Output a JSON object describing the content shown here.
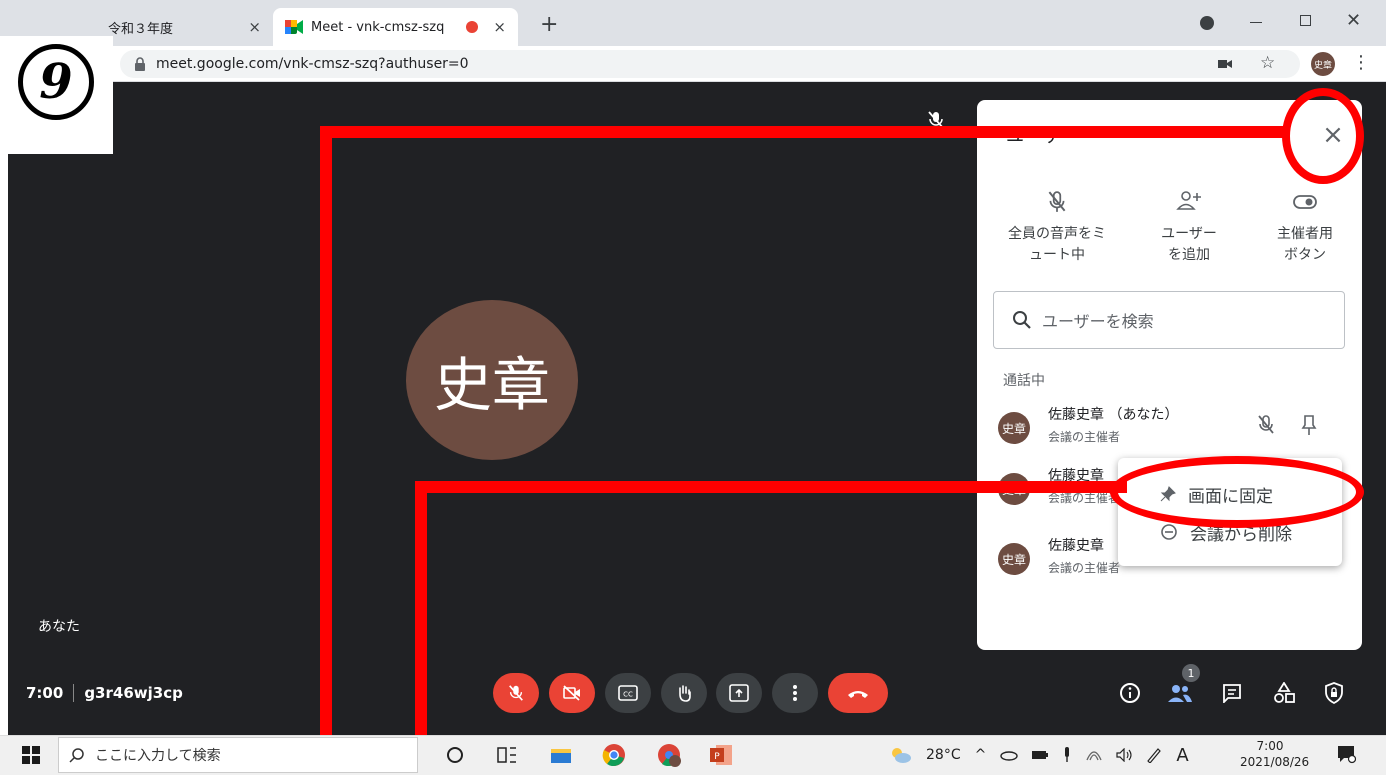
{
  "browser": {
    "tab1_title": "令和３年度",
    "tab2_title": "Meet - vnk-cmsz-szq",
    "tab_close": "×",
    "new_tab": "+",
    "url": "meet.google.com/vnk-cmsz-szq?authuser=0",
    "profile": "史章"
  },
  "step_number": "9",
  "meeting": {
    "avatar_text": "史章",
    "self_label": "あなた",
    "time": "7:00",
    "code": "g3r46wj3cp",
    "people_count": "1"
  },
  "panel": {
    "title": "ユーザー",
    "close": "×",
    "actions": [
      {
        "line1": "全員の音声をミ",
        "line2": "ュート中"
      },
      {
        "line1": "ユーザー",
        "line2": "を追加"
      },
      {
        "line1": "主催者用",
        "line2": "ボタン"
      }
    ],
    "search_placeholder": "ユーザーを検索",
    "in_call": "通話中",
    "people": [
      {
        "avatar": "史章",
        "name": "佐藤史章 （あなた）",
        "role": "会議の主催者"
      },
      {
        "avatar": "史章",
        "name": "佐藤史章",
        "role": "会議の主催者"
      },
      {
        "avatar": "史章",
        "name": "佐藤史章",
        "role": "会議の主催者"
      }
    ],
    "menu": {
      "pin": "画面に固定",
      "remove": "会議から削除"
    }
  },
  "taskbar": {
    "search": "ここに入力して検索",
    "weather": "28°C",
    "ime": "A",
    "time": "7:00",
    "date": "2021/08/26"
  },
  "colors": {
    "meet_bg": "#202124",
    "avatar": "#6d4c41",
    "danger": "#ea4335",
    "annotation": "#ff0000"
  }
}
